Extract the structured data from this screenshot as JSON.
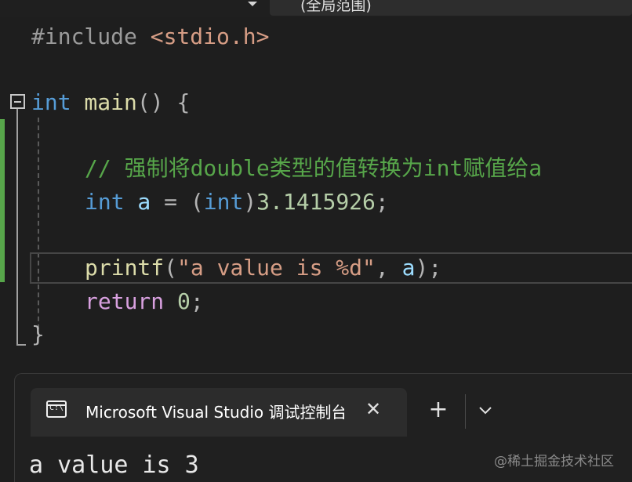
{
  "toolbar": {
    "scope_label": "(全局范围)"
  },
  "editor": {
    "line1": {
      "directive": "#include ",
      "header": "<stdio.h>"
    },
    "line2": {
      "type": "int",
      "name": " main",
      "parens": "() ",
      "brace": "{"
    },
    "line3": {
      "comment": "// 强制将double类型的值转换为int赋值给a"
    },
    "line4": {
      "type": "int",
      "var": " a",
      "assign": " = (",
      "cast": "int",
      "close": ")",
      "number": "3.1415926",
      "semi": ";"
    },
    "line5": {
      "fn": "printf",
      "open": "(",
      "string": "\"a value is %d\"",
      "comma": ", ",
      "var": "a",
      "end": ");"
    },
    "line6": {
      "keyword": "return",
      "space": " ",
      "number": "0",
      "semi": ";"
    },
    "line7": {
      "brace": "}"
    }
  },
  "terminal": {
    "tab_label": "Microsoft Visual Studio 调试控制台",
    "tab_icon_text": "C:\\",
    "close_glyph": "✕",
    "new_tab_glyph": "+",
    "output": "a value is 3"
  },
  "watermark": "@稀土掘金技术社区"
}
